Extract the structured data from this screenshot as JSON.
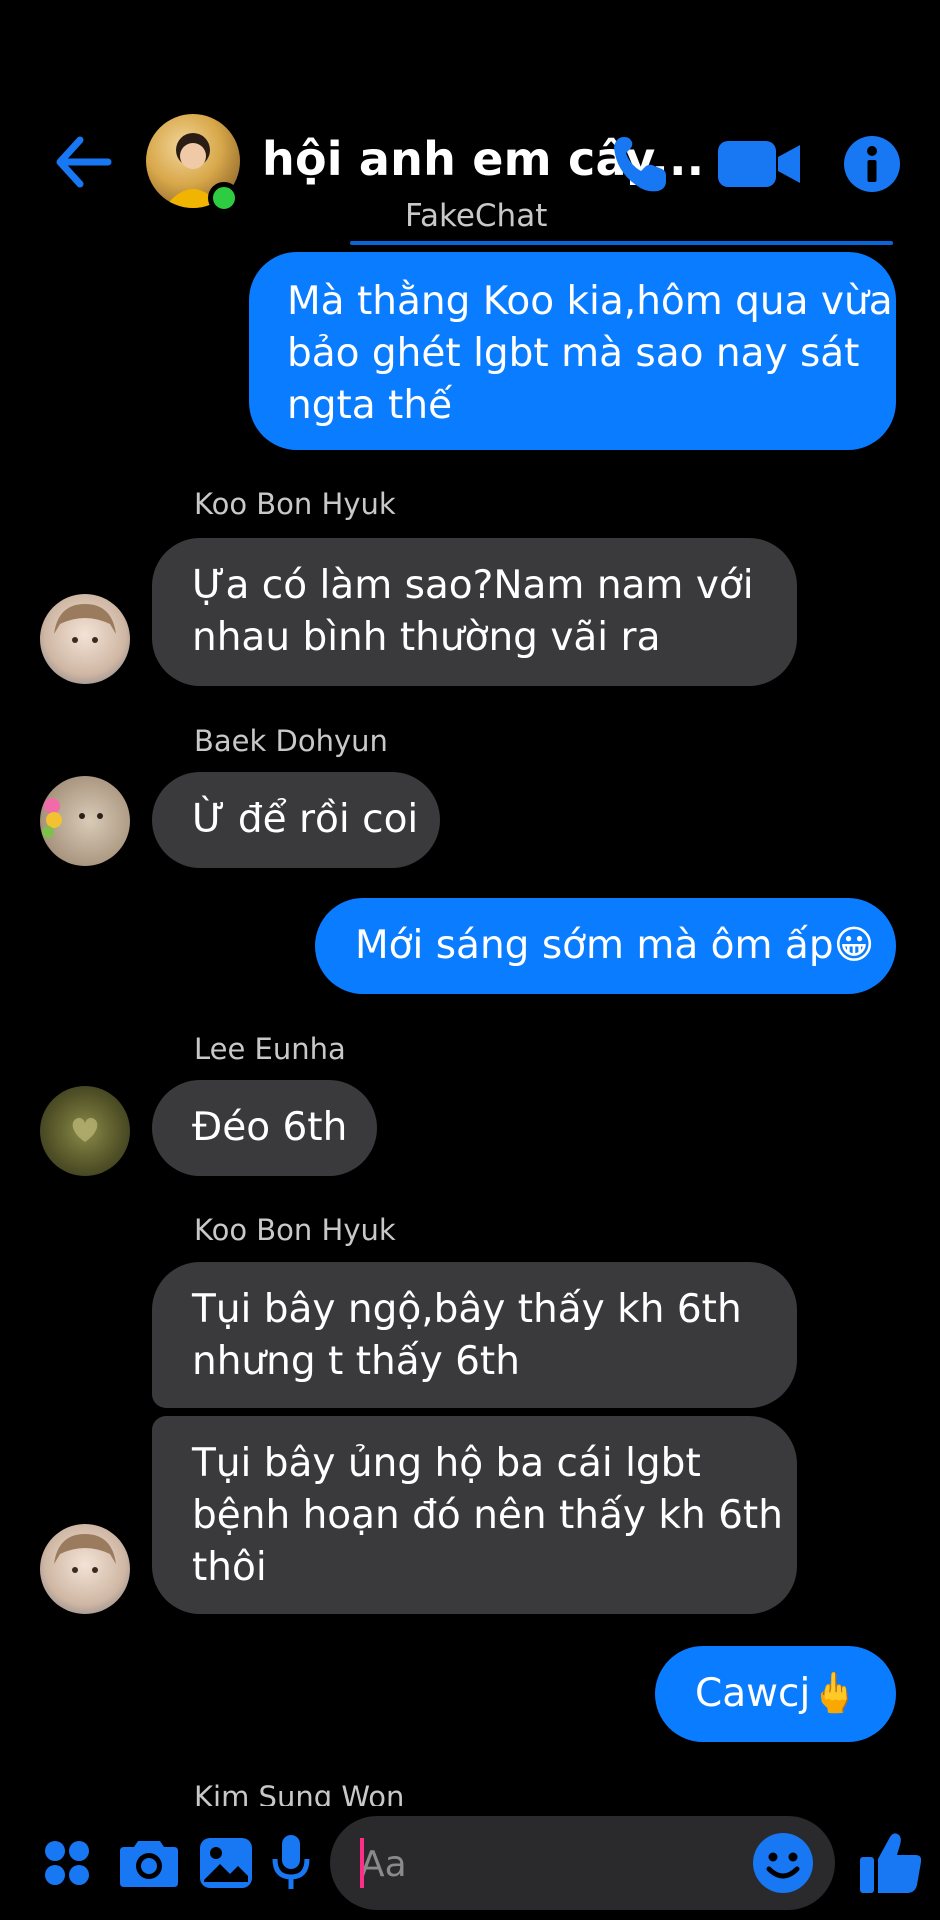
{
  "header": {
    "title": "hội anh em cây...",
    "watermark": "FakeChat"
  },
  "colors": {
    "accent": "#0a7cff",
    "incoming_bubble": "#3a3a3c",
    "online": "#2ecc40"
  },
  "messages": [
    {
      "direction": "out",
      "lines": [
        "Mà thằng Koo kia,hôm qua vừa",
        "bảo ghét lgbt mà sao nay sát",
        "ngta thế"
      ]
    },
    {
      "direction": "in",
      "sender": "Koo Bon Hyuk",
      "lines": [
        "Ựa có làm sao?Nam nam với",
        "nhau bình thường vãi ra"
      ]
    },
    {
      "direction": "in",
      "sender": "Baek Dohyun",
      "lines": [
        "Ừ để rồi coi"
      ]
    },
    {
      "direction": "out",
      "lines": [
        "Mới sáng sớm mà ôm ấp😀"
      ]
    },
    {
      "direction": "in",
      "sender": "Lee Eunha",
      "lines": [
        "Đéo 6th"
      ]
    },
    {
      "direction": "in",
      "sender": "Koo Bon Hyuk",
      "lines": [
        "Tụi bây ngộ,bây thấy kh 6th",
        "nhưng t thấy 6th"
      ]
    },
    {
      "direction": "in",
      "lines": [
        "Tụi bây ủng hộ ba cái lgbt",
        "bệnh hoạn đó nên thấy kh 6th",
        "thôi"
      ]
    },
    {
      "direction": "out",
      "lines": [
        "Cawcj🖕"
      ]
    },
    {
      "direction": "in",
      "sender": "Kim Sung Won",
      "lines": []
    }
  ],
  "composer": {
    "placeholder": "Aa"
  },
  "icons": [
    "back-arrow-icon",
    "phone-icon",
    "video-camera-icon",
    "info-icon",
    "apps-icon",
    "camera-icon",
    "gallery-icon",
    "microphone-icon",
    "emoji-icon",
    "thumbs-up-icon"
  ]
}
